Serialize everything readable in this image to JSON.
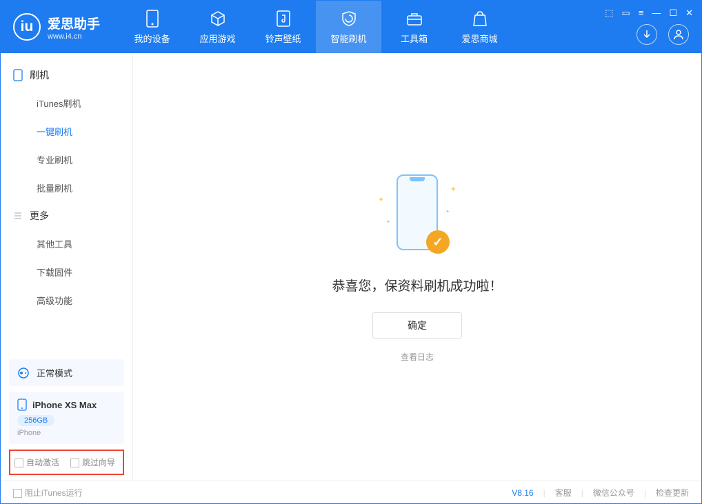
{
  "app": {
    "title": "爱思助手",
    "subtitle": "www.i4.cn"
  },
  "tabs": [
    {
      "label": "我的设备"
    },
    {
      "label": "应用游戏"
    },
    {
      "label": "铃声壁纸"
    },
    {
      "label": "智能刷机"
    },
    {
      "label": "工具箱"
    },
    {
      "label": "爱思商城"
    }
  ],
  "sidebar": {
    "group1": "刷机",
    "items1": [
      {
        "label": "iTunes刷机"
      },
      {
        "label": "一键刷机"
      },
      {
        "label": "专业刷机"
      },
      {
        "label": "批量刷机"
      }
    ],
    "group2": "更多",
    "items2": [
      {
        "label": "其他工具"
      },
      {
        "label": "下载固件"
      },
      {
        "label": "高级功能"
      }
    ],
    "mode": "正常模式",
    "device": {
      "name": "iPhone XS Max",
      "capacity": "256GB",
      "type": "iPhone"
    },
    "chk1": "自动激活",
    "chk2": "跳过向导"
  },
  "main": {
    "message": "恭喜您，保资料刷机成功啦！",
    "confirm": "确定",
    "log_link": "查看日志"
  },
  "footer": {
    "block_itunes": "阻止iTunes运行",
    "version": "V8.16",
    "service": "客服",
    "wechat": "微信公众号",
    "update": "检查更新"
  }
}
